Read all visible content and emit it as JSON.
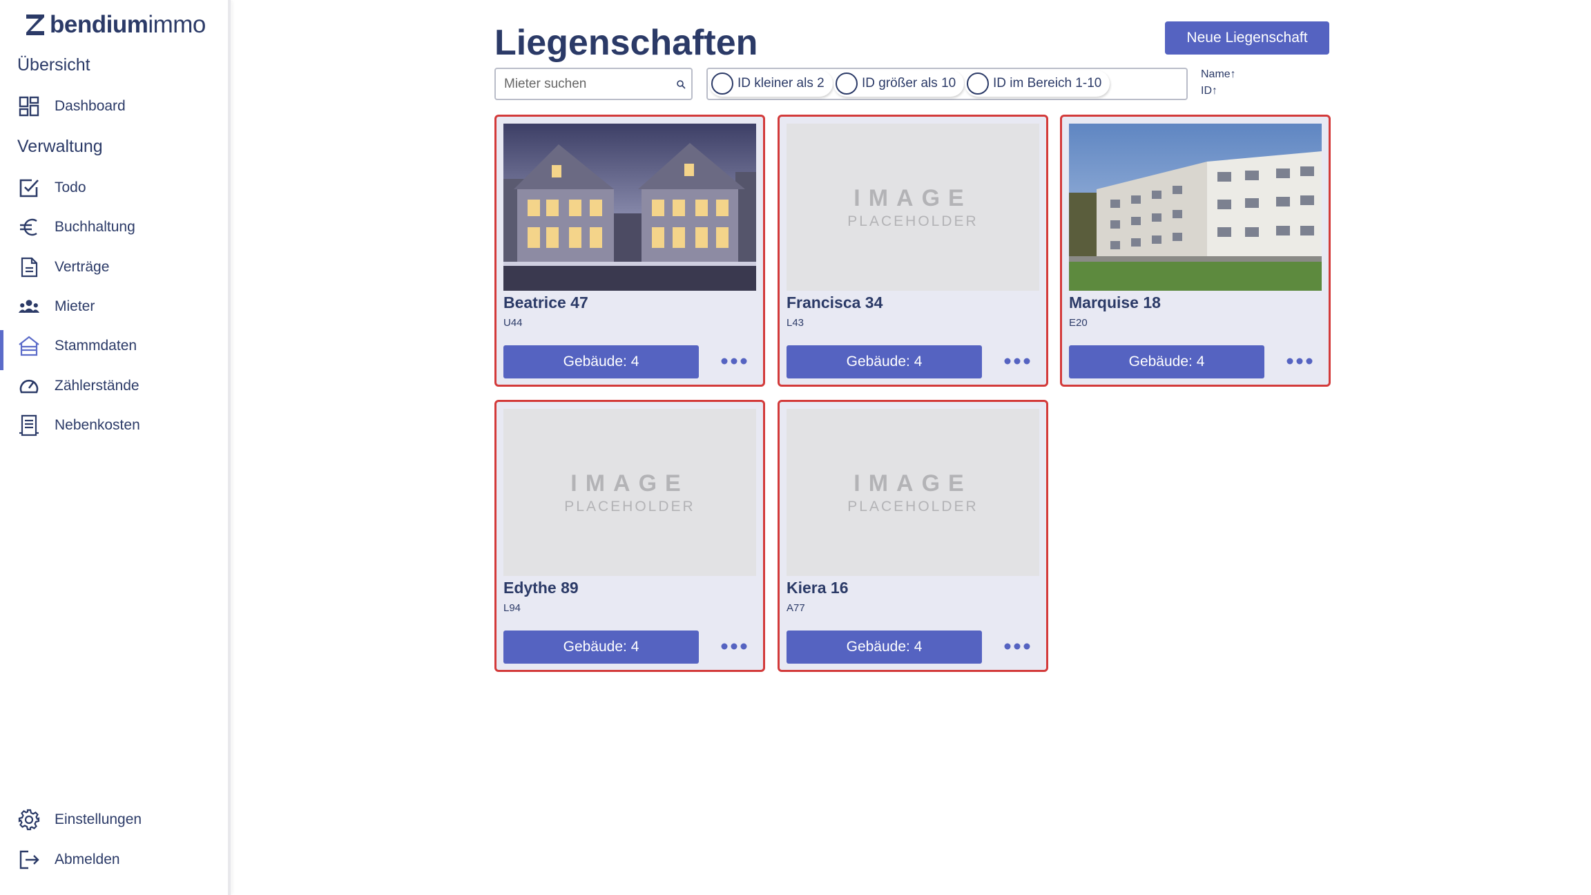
{
  "sidebar": {
    "logo": {
      "bold": "bendium",
      "light": "immo",
      "icon": "bendium-logo-mark"
    },
    "sections": {
      "overview": "Übersicht",
      "admin": "Verwaltung"
    },
    "items": [
      {
        "label": "Dashboard",
        "icon": "dashboard-icon"
      },
      {
        "label": "Todo",
        "icon": "checkbox-icon"
      },
      {
        "label": "Buchhaltung",
        "icon": "euro-icon"
      },
      {
        "label": "Verträge",
        "icon": "document-icon"
      },
      {
        "label": "Mieter",
        "icon": "people-icon"
      },
      {
        "label": "Stammdaten",
        "icon": "building-icon",
        "active": true
      },
      {
        "label": "Zählerstände",
        "icon": "gauge-icon"
      },
      {
        "label": "Nebenkosten",
        "icon": "receipt-icon"
      }
    ],
    "bottom": [
      {
        "label": "Einstellungen",
        "icon": "gear-icon"
      },
      {
        "label": "Abmelden",
        "icon": "logout-icon"
      }
    ]
  },
  "header": {
    "title": "Liegenschaften",
    "new_button": "Neue Liegenschaft"
  },
  "search": {
    "placeholder": "Mieter suchen",
    "value": ""
  },
  "filters": [
    {
      "label": "ID kleiner als 2",
      "selected": false
    },
    {
      "label": "ID größer als 10",
      "selected": false
    },
    {
      "label": "ID im Bereich 1-10",
      "selected": false
    }
  ],
  "sort": [
    {
      "label": "Name↑"
    },
    {
      "label": "ID↑"
    }
  ],
  "placeholder": {
    "line1": "IMAGE",
    "line2": "PLACEHOLDER"
  },
  "properties": [
    {
      "name": "Beatrice 47",
      "code": "U44",
      "buildings": "Gebäude: 4",
      "image": "photo-villas-night"
    },
    {
      "name": "Francisca 34",
      "code": "L43",
      "buildings": "Gebäude: 4",
      "image": "placeholder"
    },
    {
      "name": "Marquise 18",
      "code": "E20",
      "buildings": "Gebäude: 4",
      "image": "photo-apartment-block"
    },
    {
      "name": "Edythe 89",
      "code": "L94",
      "buildings": "Gebäude: 4",
      "image": "placeholder"
    },
    {
      "name": "Kiera 16",
      "code": "A77",
      "buildings": "Gebäude: 4",
      "image": "placeholder"
    }
  ],
  "colors": {
    "primary": "#5563c1",
    "text": "#2b3a67",
    "card_border": "#d33a3a",
    "card_bg": "#e8e9f3",
    "active_indicator": "#5b6bc9"
  }
}
